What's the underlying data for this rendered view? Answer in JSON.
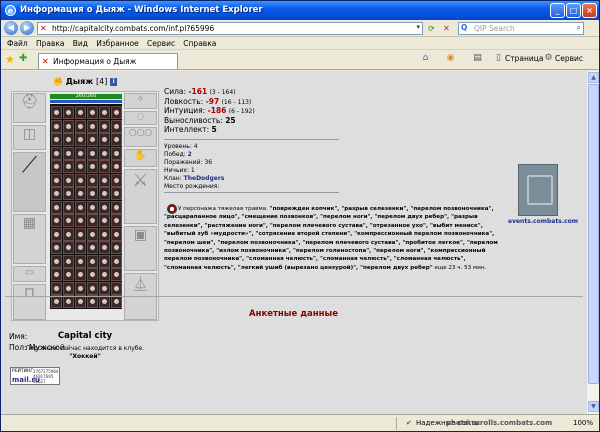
{
  "window": {
    "title": "Информация о Дыяж - Windows Internet Explorer"
  },
  "address_bar": {
    "url": "http://capitalcity.combats.com/inf.pl?65996",
    "search_placeholder": "QIP Search"
  },
  "menu": [
    "Файл",
    "Правка",
    "Вид",
    "Избранное",
    "Сервис",
    "Справка"
  ],
  "tab": {
    "label": "Информация о Дыяж"
  },
  "toolbar": {
    "page_label": "Страница",
    "service_label": "Сервис"
  },
  "character": {
    "name": "Дыяж",
    "level": "[4]",
    "info_icon": "i",
    "hp_text": "260/260",
    "city": "Capital city",
    "location_line": "Персонаж сейчас находится в клубе.",
    "location_room": "\"Хоккей\""
  },
  "stats": [
    {
      "label": "Сила:",
      "value": "-161",
      "range": "(3 - 164)"
    },
    {
      "label": "Ловкость:",
      "value": "-97",
      "range": "(16 - 113)"
    },
    {
      "label": "Интуиция:",
      "value": "-186",
      "range": "(6 - 192)"
    },
    {
      "label": "Выносливость:",
      "value": "25",
      "range": ""
    },
    {
      "label": "Интеллект:",
      "value": "5",
      "range": ""
    }
  ],
  "info": {
    "level_label": "Уровень:",
    "level_value": "4",
    "wins_label": "Побед:",
    "wins_value": "2",
    "losses_label": "Поражений:",
    "losses_value": "36",
    "draws_label": "Ничьих:",
    "draws_value": "1",
    "clan_label": "Клан:",
    "clan_value": "TheDodgers",
    "birthplace_label": "Место рождения:"
  },
  "trauma": {
    "intro": "У персонажа тяжелая травма.",
    "list": "\"поврежден копчик\", \"разрыв селезенки\", \"перелом позвоночника\", \"расцарапанное лицо\", \"смещение позвонков\", \"перелом ноги\", \"перелом двух ребер\", \"разрыв селезенки\", \"растяжение ноги\", \"перелом плечевого сустава\", \"отрезанное ухо\", \"выбит мениск\", \"выбитый зуб «мудрости»\", \"сотрясение второй степени\", \"компрессионный перелом позвоночника\", \"перелом шеи\", \"перелом позвоночника\", \"перелом плечевого сустава\", \"пробитое легкое\", \"перелом позвоночника\", \"излом позвоночника\", \"перелом голеностопа\", \"перелом ноги\", \"компрессионный перелом позвоночника\", \"сломанная челюсть\", \"сломанная челюсть\", \"сломанная челюсть\", \"сломанная челюсть\", \"легкий ушиб (вырезано цензурой)\", \"перелом двух ребер\"",
    "remaining": " еще 23 ч. 53 мин."
  },
  "events_link": "events.combats.com",
  "profile": {
    "heading": "Анкетные данные",
    "name_label": "Имя:",
    "sex_label": "Пол:",
    "sex_value": "Мужской"
  },
  "counter": {
    "brand": "mail.ru",
    "top": "РЕЙТИНГ",
    "line1": "2767275964",
    "line2": "46917695",
    "line3": "46627"
  },
  "status_bar": {
    "zone": "Надежные сайты",
    "zoom": "100%",
    "watermark": "photo.scrolls.combats.com"
  }
}
